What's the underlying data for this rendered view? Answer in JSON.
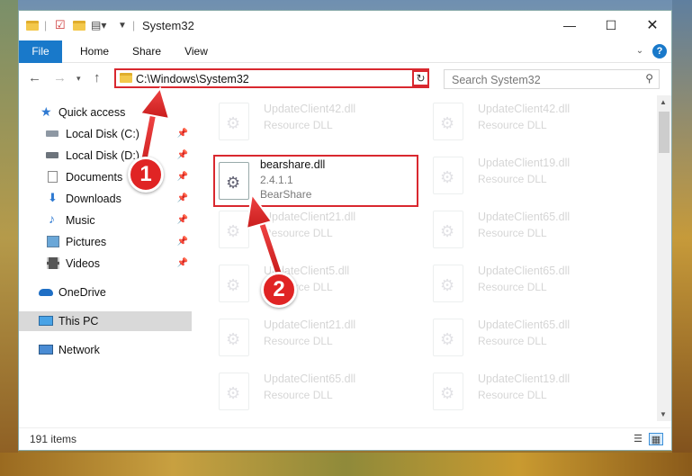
{
  "window": {
    "title": "System32"
  },
  "ribbon": {
    "tabs": [
      "File",
      "Home",
      "Share",
      "View"
    ]
  },
  "address": {
    "path": "C:\\Windows\\System32"
  },
  "search": {
    "placeholder": "Search System32"
  },
  "sidebar": {
    "items": [
      {
        "label": "Quick access",
        "pinned": false
      },
      {
        "label": "Local Disk (C:)",
        "pinned": true
      },
      {
        "label": "Local Disk (D:)",
        "pinned": true
      },
      {
        "label": "Documents",
        "pinned": true
      },
      {
        "label": "Downloads",
        "pinned": true
      },
      {
        "label": "Music",
        "pinned": true
      },
      {
        "label": "Pictures",
        "pinned": true
      },
      {
        "label": "Videos",
        "pinned": true
      },
      {
        "label": "OneDrive",
        "pinned": false
      },
      {
        "label": "This PC",
        "pinned": false
      },
      {
        "label": "Network",
        "pinned": false
      }
    ]
  },
  "files": {
    "highlighted": {
      "name": "bearshare.dll",
      "version": "2.4.1.1",
      "company": "BearShare"
    },
    "left_column": [
      {
        "name": "UpdateClient42.dll",
        "type": "Resource DLL"
      },
      {
        "name": "UpdateClient21.dll",
        "type": "Resource DLL"
      },
      {
        "name": "UpdateClient5.dll",
        "type": "Resource DLL"
      },
      {
        "name": "UpdateClient21.dll",
        "type": "Resource DLL"
      },
      {
        "name": "UpdateClient65.dll",
        "type": "Resource DLL"
      }
    ],
    "right_column": [
      {
        "name": "UpdateClient42.dll",
        "type": "Resource DLL"
      },
      {
        "name": "UpdateClient19.dll",
        "type": "Resource DLL"
      },
      {
        "name": "UpdateClient65.dll",
        "type": "Resource DLL"
      },
      {
        "name": "UpdateClient65.dll",
        "type": "Resource DLL"
      },
      {
        "name": "UpdateClient65.dll",
        "type": "Resource DLL"
      },
      {
        "name": "UpdateClient19.dll",
        "type": "Resource DLL"
      }
    ]
  },
  "status": {
    "count": "191 items"
  },
  "callouts": [
    "1",
    "2"
  ]
}
